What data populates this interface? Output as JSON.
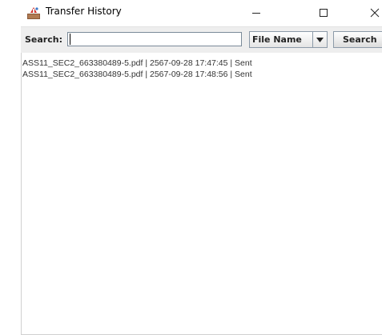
{
  "window": {
    "title": "Transfer History"
  },
  "toolbar": {
    "search_label": "Search:",
    "search_value": "",
    "filter_selected": "File Name",
    "search_button_label": "Search"
  },
  "history": {
    "items": [
      "ASS11_SEC2_663380489-5.pdf | 2567-09-28 17:47:45 | Sent",
      "ASS11_SEC2_663380489-5.pdf | 2567-09-28 17:48:56 | Sent"
    ]
  },
  "icons": {
    "app": "java-app-icon",
    "minimize": "minimize-icon",
    "maximize": "maximize-icon",
    "close": "close-icon",
    "dropdown": "triangle-down-icon"
  }
}
